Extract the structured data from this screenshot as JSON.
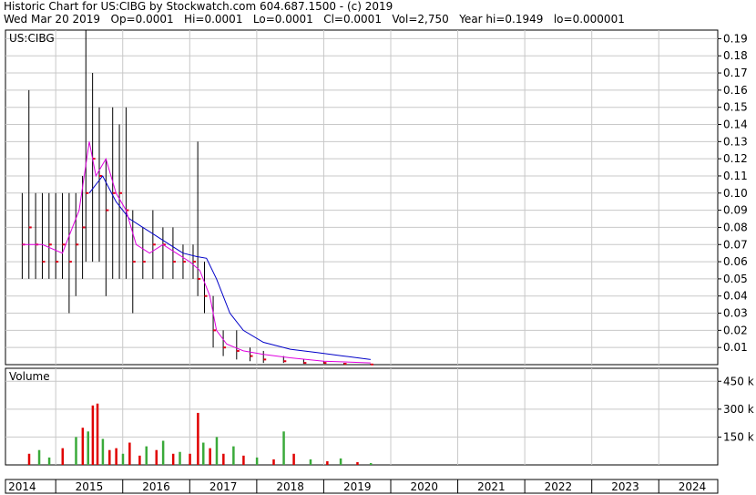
{
  "header": {
    "line1": "Historic Chart for US:CIBG by Stockwatch.com 604.687.1500 - (c) 2019",
    "line2": "Wed Mar 20 2019   Op=0.0001   Hi=0.0001   Lo=0.0001   Cl=0.0001   Vol=2,750   Year hi=0.1949   lo=0.000001"
  },
  "colors": {
    "price_bar": "#000000",
    "close_marker": "#e0001b",
    "ma_short": "#e000e0",
    "ma_long": "#0000c8",
    "vol_up": "#3aaa3a",
    "vol_down": "#e00000",
    "grid": "#c8c8c8"
  },
  "chart_data": [
    {
      "type": "line",
      "ticker_label": "US:CIBG",
      "ylim": [
        0,
        0.195
      ],
      "y_ticks": [
        "0.19",
        "0.18",
        "0.17",
        "0.16",
        "0.15",
        "0.14",
        "0.13",
        "0.12",
        "0.11",
        "0.10",
        "0.09",
        "0.08",
        "0.07",
        "0.06",
        "0.05",
        "0.04",
        "0.03",
        "0.02",
        "0.01"
      ],
      "grid": true,
      "price_bars": [
        {
          "x": 2014.0,
          "h": 0.1,
          "l": 0.05,
          "c": 0.07
        },
        {
          "x": 2014.1,
          "h": 0.16,
          "l": 0.05,
          "c": 0.08
        },
        {
          "x": 2014.2,
          "h": 0.1,
          "l": 0.05,
          "c": 0.07
        },
        {
          "x": 2014.3,
          "h": 0.1,
          "l": 0.05,
          "c": 0.06
        },
        {
          "x": 2014.4,
          "h": 0.1,
          "l": 0.05,
          "c": 0.07
        },
        {
          "x": 2014.5,
          "h": 0.1,
          "l": 0.05,
          "c": 0.06
        },
        {
          "x": 2014.6,
          "h": 0.1,
          "l": 0.05,
          "c": 0.07
        },
        {
          "x": 2014.7,
          "h": 0.1,
          "l": 0.03,
          "c": 0.06
        },
        {
          "x": 2014.8,
          "h": 0.1,
          "l": 0.04,
          "c": 0.07
        },
        {
          "x": 2014.9,
          "h": 0.11,
          "l": 0.05,
          "c": 0.08
        },
        {
          "x": 2014.95,
          "h": 0.195,
          "l": 0.06,
          "c": 0.1
        },
        {
          "x": 2015.05,
          "h": 0.17,
          "l": 0.06,
          "c": 0.12
        },
        {
          "x": 2015.15,
          "h": 0.15,
          "l": 0.06,
          "c": 0.11
        },
        {
          "x": 2015.25,
          "h": 0.12,
          "l": 0.04,
          "c": 0.09
        },
        {
          "x": 2015.35,
          "h": 0.15,
          "l": 0.05,
          "c": 0.1
        },
        {
          "x": 2015.45,
          "h": 0.14,
          "l": 0.05,
          "c": 0.1
        },
        {
          "x": 2015.55,
          "h": 0.15,
          "l": 0.05,
          "c": 0.09
        },
        {
          "x": 2015.65,
          "h": 0.09,
          "l": 0.03,
          "c": 0.06
        },
        {
          "x": 2015.8,
          "h": 0.08,
          "l": 0.05,
          "c": 0.06
        },
        {
          "x": 2015.95,
          "h": 0.09,
          "l": 0.05,
          "c": 0.07
        },
        {
          "x": 2016.1,
          "h": 0.08,
          "l": 0.05,
          "c": 0.07
        },
        {
          "x": 2016.25,
          "h": 0.08,
          "l": 0.05,
          "c": 0.06
        },
        {
          "x": 2016.4,
          "h": 0.07,
          "l": 0.05,
          "c": 0.06
        },
        {
          "x": 2016.55,
          "h": 0.07,
          "l": 0.05,
          "c": 0.06
        },
        {
          "x": 2016.62,
          "h": 0.13,
          "l": 0.04,
          "c": 0.05
        },
        {
          "x": 2016.72,
          "h": 0.06,
          "l": 0.03,
          "c": 0.04
        },
        {
          "x": 2016.85,
          "h": 0.04,
          "l": 0.01,
          "c": 0.02
        },
        {
          "x": 2017.0,
          "h": 0.02,
          "l": 0.005,
          "c": 0.01
        },
        {
          "x": 2017.2,
          "h": 0.02,
          "l": 0.003,
          "c": 0.008
        },
        {
          "x": 2017.4,
          "h": 0.01,
          "l": 0.002,
          "c": 0.005
        },
        {
          "x": 2017.6,
          "h": 0.008,
          "l": 0.001,
          "c": 0.003
        },
        {
          "x": 2017.9,
          "h": 0.005,
          "l": 0.001,
          "c": 0.002
        },
        {
          "x": 2018.2,
          "h": 0.003,
          "l": 0.0005,
          "c": 0.001
        },
        {
          "x": 2018.5,
          "h": 0.002,
          "l": 0.0003,
          "c": 0.001
        },
        {
          "x": 2018.8,
          "h": 0.001,
          "l": 0.0002,
          "c": 0.0005
        },
        {
          "x": 2019.2,
          "h": 0.0005,
          "l": 0.0001,
          "c": 0.0001
        }
      ],
      "ma_short": [
        [
          2014.0,
          0.07
        ],
        [
          2014.3,
          0.07
        ],
        [
          2014.6,
          0.065
        ],
        [
          2014.85,
          0.09
        ],
        [
          2015.0,
          0.13
        ],
        [
          2015.1,
          0.11
        ],
        [
          2015.25,
          0.12
        ],
        [
          2015.4,
          0.1
        ],
        [
          2015.55,
          0.09
        ],
        [
          2015.7,
          0.07
        ],
        [
          2015.9,
          0.065
        ],
        [
          2016.1,
          0.07
        ],
        [
          2016.3,
          0.065
        ],
        [
          2016.5,
          0.06
        ],
        [
          2016.65,
          0.055
        ],
        [
          2016.8,
          0.04
        ],
        [
          2016.9,
          0.02
        ],
        [
          2017.05,
          0.012
        ],
        [
          2017.3,
          0.008
        ],
        [
          2017.6,
          0.006
        ],
        [
          2018.0,
          0.004
        ],
        [
          2018.5,
          0.002
        ],
        [
          2019.2,
          0.001
        ]
      ],
      "ma_long": [
        [
          2015.0,
          0.1
        ],
        [
          2015.2,
          0.11
        ],
        [
          2015.4,
          0.095
        ],
        [
          2015.6,
          0.085
        ],
        [
          2015.8,
          0.08
        ],
        [
          2016.0,
          0.075
        ],
        [
          2016.2,
          0.07
        ],
        [
          2016.4,
          0.065
        ],
        [
          2016.6,
          0.063
        ],
        [
          2016.75,
          0.062
        ],
        [
          2016.9,
          0.05
        ],
        [
          2017.1,
          0.03
        ],
        [
          2017.3,
          0.02
        ],
        [
          2017.6,
          0.013
        ],
        [
          2018.0,
          0.009
        ],
        [
          2018.4,
          0.007
        ],
        [
          2018.8,
          0.005
        ],
        [
          2019.2,
          0.003
        ]
      ]
    },
    {
      "type": "bar",
      "label": "Volume",
      "ylim": [
        0,
        520
      ],
      "y_ticks": [
        "450 k",
        "300 k",
        "150 k"
      ],
      "y_tick_values": [
        450,
        300,
        150
      ],
      "unit": "k",
      "bars": [
        {
          "x": 2014.1,
          "v": 60,
          "up": false
        },
        {
          "x": 2014.25,
          "v": 80,
          "up": true
        },
        {
          "x": 2014.4,
          "v": 40,
          "up": true
        },
        {
          "x": 2014.6,
          "v": 90,
          "up": false
        },
        {
          "x": 2014.8,
          "v": 150,
          "up": true
        },
        {
          "x": 2014.9,
          "v": 200,
          "up": false
        },
        {
          "x": 2014.98,
          "v": 180,
          "up": true
        },
        {
          "x": 2015.05,
          "v": 320,
          "up": false
        },
        {
          "x": 2015.12,
          "v": 330,
          "up": false
        },
        {
          "x": 2015.2,
          "v": 140,
          "up": true
        },
        {
          "x": 2015.3,
          "v": 80,
          "up": false
        },
        {
          "x": 2015.4,
          "v": 90,
          "up": false
        },
        {
          "x": 2015.5,
          "v": 60,
          "up": true
        },
        {
          "x": 2015.6,
          "v": 120,
          "up": false
        },
        {
          "x": 2015.75,
          "v": 50,
          "up": false
        },
        {
          "x": 2015.85,
          "v": 100,
          "up": true
        },
        {
          "x": 2016.0,
          "v": 80,
          "up": false
        },
        {
          "x": 2016.1,
          "v": 130,
          "up": true
        },
        {
          "x": 2016.25,
          "v": 60,
          "up": false
        },
        {
          "x": 2016.35,
          "v": 70,
          "up": true
        },
        {
          "x": 2016.5,
          "v": 60,
          "up": false
        },
        {
          "x": 2016.62,
          "v": 280,
          "up": false
        },
        {
          "x": 2016.7,
          "v": 120,
          "up": true
        },
        {
          "x": 2016.8,
          "v": 90,
          "up": false
        },
        {
          "x": 2016.9,
          "v": 150,
          "up": true
        },
        {
          "x": 2017.0,
          "v": 60,
          "up": false
        },
        {
          "x": 2017.15,
          "v": 100,
          "up": true
        },
        {
          "x": 2017.3,
          "v": 50,
          "up": false
        },
        {
          "x": 2017.5,
          "v": 40,
          "up": true
        },
        {
          "x": 2017.75,
          "v": 30,
          "up": false
        },
        {
          "x": 2017.9,
          "v": 180,
          "up": true
        },
        {
          "x": 2018.05,
          "v": 60,
          "up": false
        },
        {
          "x": 2018.3,
          "v": 30,
          "up": true
        },
        {
          "x": 2018.55,
          "v": 20,
          "up": false
        },
        {
          "x": 2018.75,
          "v": 35,
          "up": true
        },
        {
          "x": 2019.0,
          "v": 15,
          "up": false
        },
        {
          "x": 2019.2,
          "v": 10,
          "up": true
        }
      ]
    }
  ],
  "x_axis": {
    "xlim": [
      2013.75,
      2024.38
    ],
    "year_labels": [
      {
        "label": "2014",
        "x": 2014.0
      },
      {
        "label": "2015",
        "x": 2015.0
      },
      {
        "label": "2016",
        "x": 2016.0
      },
      {
        "label": "2017",
        "x": 2017.0
      },
      {
        "label": "2018",
        "x": 2018.0
      },
      {
        "label": "2019",
        "x": 2019.0
      },
      {
        "label": "2020",
        "x": 2020.0
      },
      {
        "label": "2021",
        "x": 2021.0
      },
      {
        "label": "2022",
        "x": 2022.0
      },
      {
        "label": "2023",
        "x": 2023.0
      },
      {
        "label": "2024",
        "x": 2024.0
      }
    ],
    "year_boundaries": [
      2014.5,
      2015.5,
      2016.5,
      2017.5,
      2018.5,
      2019.5,
      2020.5,
      2021.5,
      2022.5,
      2023.5
    ]
  }
}
